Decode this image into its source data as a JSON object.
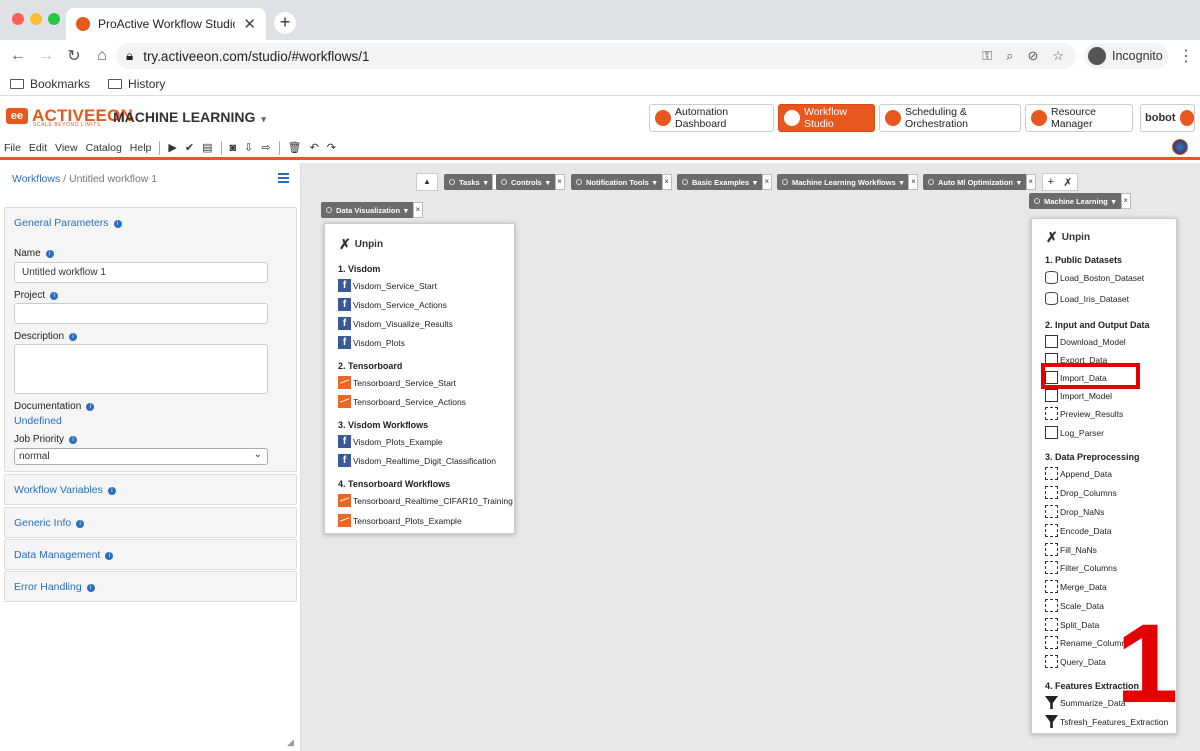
{
  "browser": {
    "tab_title": "ProActive Workflow Studio",
    "url": "try.activeeon.com/studio/#workflows/1",
    "profile": "Incognito",
    "bookmarks": [
      "Bookmarks",
      "History"
    ]
  },
  "app": {
    "logo": "ACTIVEEON",
    "logo_tagline": "SCALE BEYOND LIMITS",
    "title": "MACHINE LEARNING",
    "portals": [
      "Automation Dashboard",
      "Workflow Studio",
      "Scheduling & Orchestration",
      "Resource Manager"
    ],
    "user": "bobot",
    "menu": [
      "File",
      "Edit",
      "View",
      "Catalog",
      "Help"
    ]
  },
  "left": {
    "breadcrumb_root": "Workflows",
    "breadcrumb_current": "Untitled workflow 1",
    "general_params": "General Parameters",
    "name_label": "Name",
    "name_value": "Untitled workflow 1",
    "project_label": "Project",
    "description_label": "Description",
    "documentation_label": "Documentation",
    "documentation_value": "Undefined",
    "priority_label": "Job Priority",
    "priority_value": "normal",
    "sections": [
      "Workflow Variables",
      "Generic Info",
      "Data Management",
      "Error Handling"
    ]
  },
  "buckets": {
    "row1": [
      "Tasks",
      "Controls",
      "Notification Tools",
      "Basic Examples",
      "Machine Learning Workflows",
      "Auto Ml Optimization"
    ],
    "data_vis": "Data Visualization",
    "ml": "Machine Learning"
  },
  "dv_panel": {
    "unpin": "Unpin",
    "s1": "1. Visdom",
    "i1": [
      "Visdom_Service_Start",
      "Visdom_Service_Actions",
      "Visdom_Visualize_Results",
      "Visdom_Plots"
    ],
    "s2": "2. Tensorboard",
    "i2": [
      "Tensorboard_Service_Start",
      "Tensorboard_Service_Actions"
    ],
    "s3": "3. Visdom Workflows",
    "i3": [
      "Visdom_Plots_Example",
      "Visdom_Realtime_Digit_Classification"
    ],
    "s4": "4. Tensorboard Workflows",
    "i4": [
      "Tensorboard_Realtime_CIFAR10_Training",
      "Tensorboard_Plots_Example"
    ]
  },
  "ml_panel": {
    "unpin": "Unpin",
    "s1": "1. Public Datasets",
    "i1": [
      "Load_Boston_Dataset",
      "Load_Iris_Dataset"
    ],
    "s2": "2. Input and Output Data",
    "i2": [
      "Download_Model",
      "Export_Data",
      "Import_Data",
      "Import_Model",
      "Preview_Results",
      "Log_Parser"
    ],
    "s3": "3. Data Preprocessing",
    "i3": [
      "Append_Data",
      "Drop_Columns",
      "Drop_NaNs",
      "Encode_Data",
      "Fill_NaNs",
      "Filter_Columns",
      "Merge_Data",
      "Scale_Data",
      "Split_Data",
      "Rename_Columns",
      "Query_Data"
    ],
    "s4": "4. Features Extraction",
    "i4": [
      "Summarize_Data",
      "Tsfresh_Features_Extraction"
    ]
  },
  "annotation": "1",
  "colors": {
    "accent": "#e8571e",
    "link": "#2a6ebb",
    "highlight": "#e30000"
  }
}
